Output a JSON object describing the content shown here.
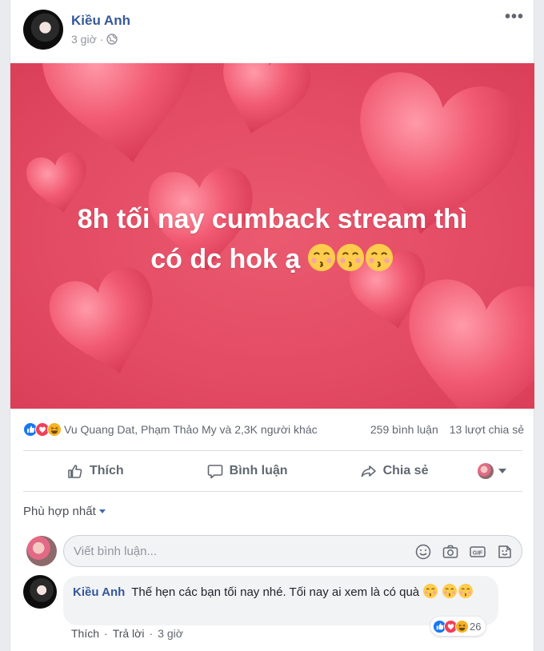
{
  "post": {
    "author": "Kiều Anh",
    "time": "3 giờ",
    "privacy_icon": "globe-icon",
    "more_label": "•••",
    "banner_text_line1": "8h tối nay cumback stream thì",
    "banner_text_line2": "có dc hok ạ",
    "banner_emoji": "kissing-smiling-eyes-emoji",
    "banner_colors": {
      "background": "#e34a63",
      "heart": "#f26a80"
    }
  },
  "stats": {
    "reaction_icons": [
      "like-icon",
      "love-icon",
      "haha-icon"
    ],
    "reactors": "Vu Quang Dat, Phạm Thảo My và 2,3K người khác",
    "comments": "259 bình luận",
    "shares": "13 lượt chia sẻ"
  },
  "actions": {
    "like": "Thích",
    "comment": "Bình luận",
    "share": "Chia sẻ"
  },
  "comments_section": {
    "sort_label": "Phù hợp nhất",
    "input_placeholder": "Viết bình luận...",
    "input_icons": [
      "emoji-icon",
      "camera-icon",
      "gif-icon",
      "sticker-icon"
    ]
  },
  "comment": {
    "author": "Kiều Anh",
    "text": "Thế hẹn các bạn tối nay nhé. Tối nay ai xem là có quà",
    "reaction_count": "26",
    "like": "Thích",
    "reply": "Trả lời",
    "time": "3 giờ"
  },
  "colors": {
    "link": "#365899",
    "like_blue": "#1877f2",
    "love_red": "#f33e58",
    "haha_yellow": "#f7b125"
  }
}
